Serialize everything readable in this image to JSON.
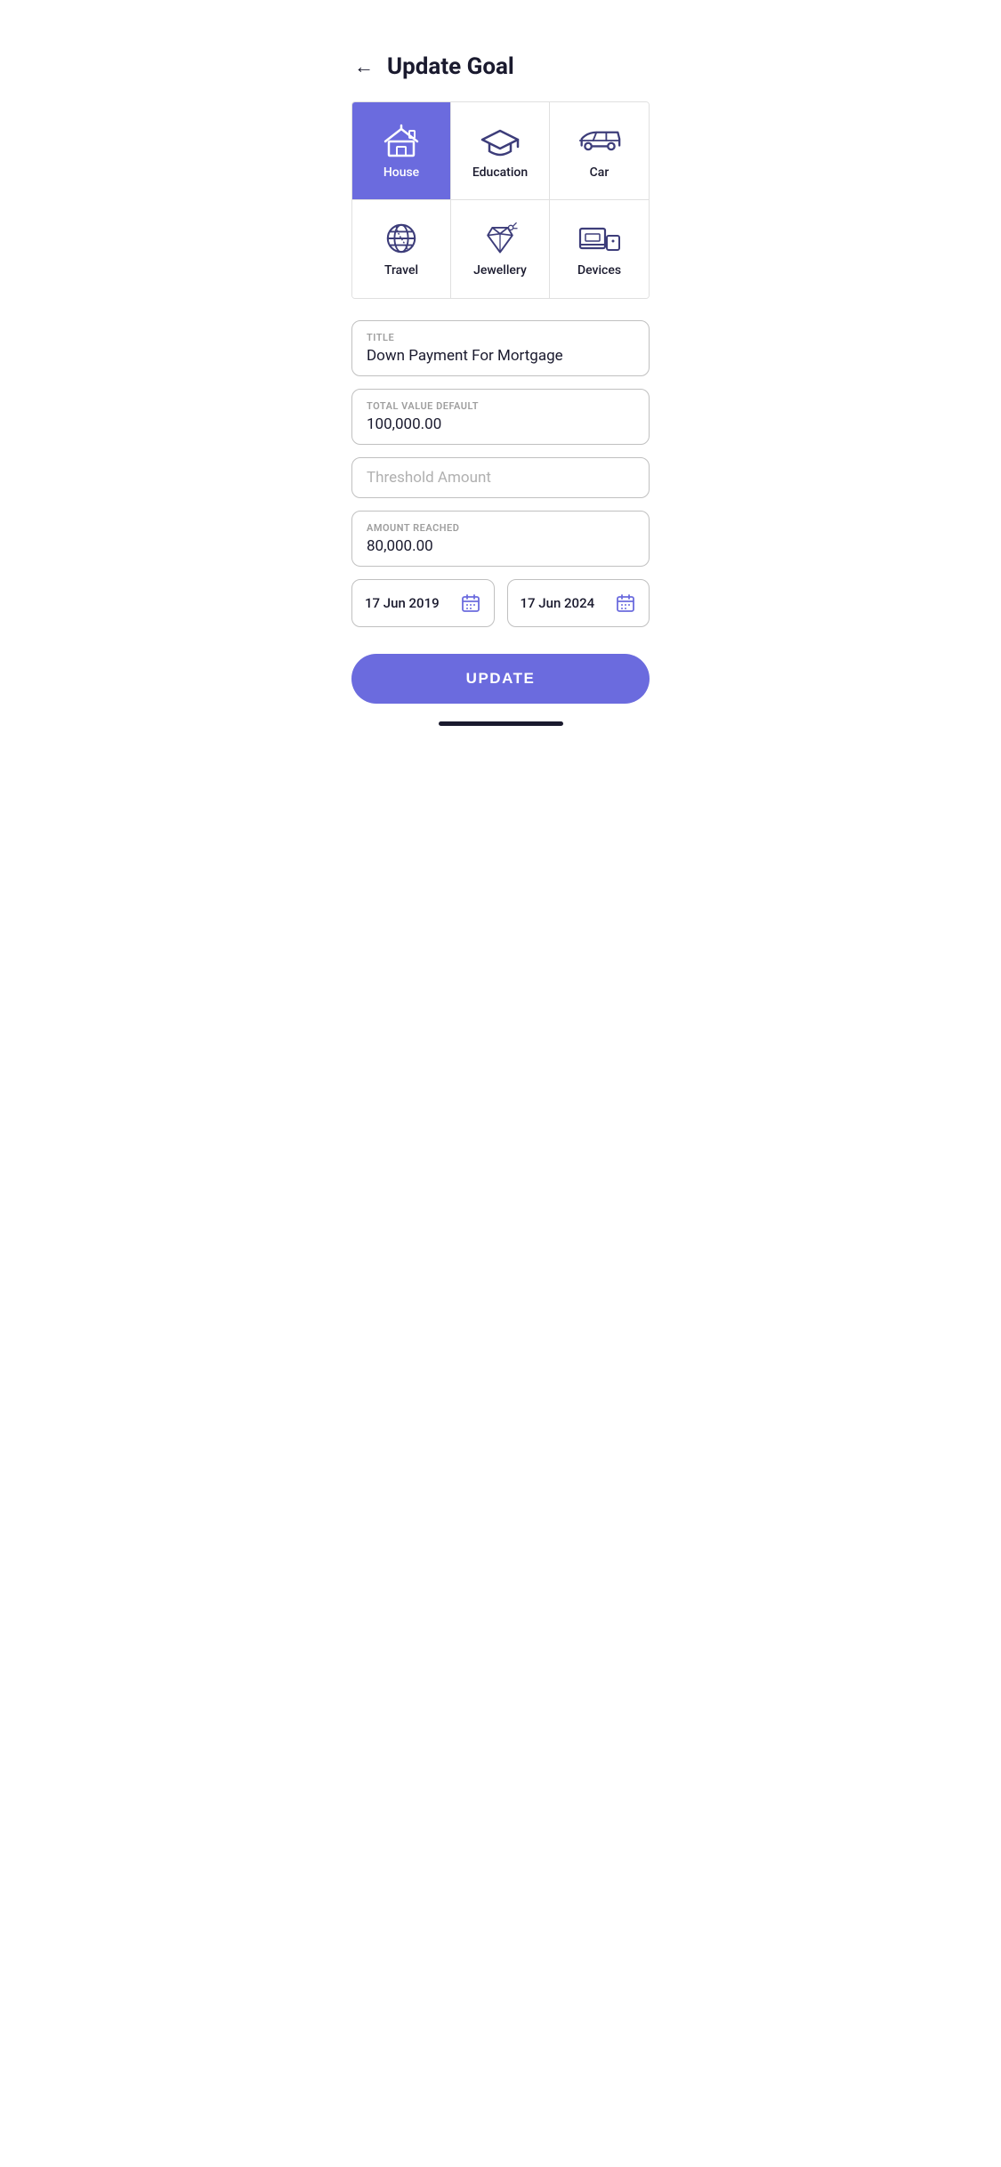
{
  "header": {
    "back_label": "←",
    "title": "Update Goal"
  },
  "categories": [
    {
      "id": "house",
      "label": "House",
      "active": true
    },
    {
      "id": "education",
      "label": "Education",
      "active": false
    },
    {
      "id": "car",
      "label": "Car",
      "active": false
    },
    {
      "id": "travel",
      "label": "Travel",
      "active": false
    },
    {
      "id": "jewellery",
      "label": "Jewellery",
      "active": false
    },
    {
      "id": "devices",
      "label": "Devices",
      "active": false
    }
  ],
  "form": {
    "title_label": "TITLE",
    "title_value": "Down Payment For Mortgage",
    "total_label": "TOTAL VALUE DEFAULT",
    "total_value": "100,000.00",
    "threshold_placeholder": "Threshold Amount",
    "amount_label": "AMOUNT REACHED",
    "amount_value": "80,000.00"
  },
  "dates": {
    "start": "17 Jun 2019",
    "end": "17 Jun 2024"
  },
  "update_button": "UPDATE"
}
